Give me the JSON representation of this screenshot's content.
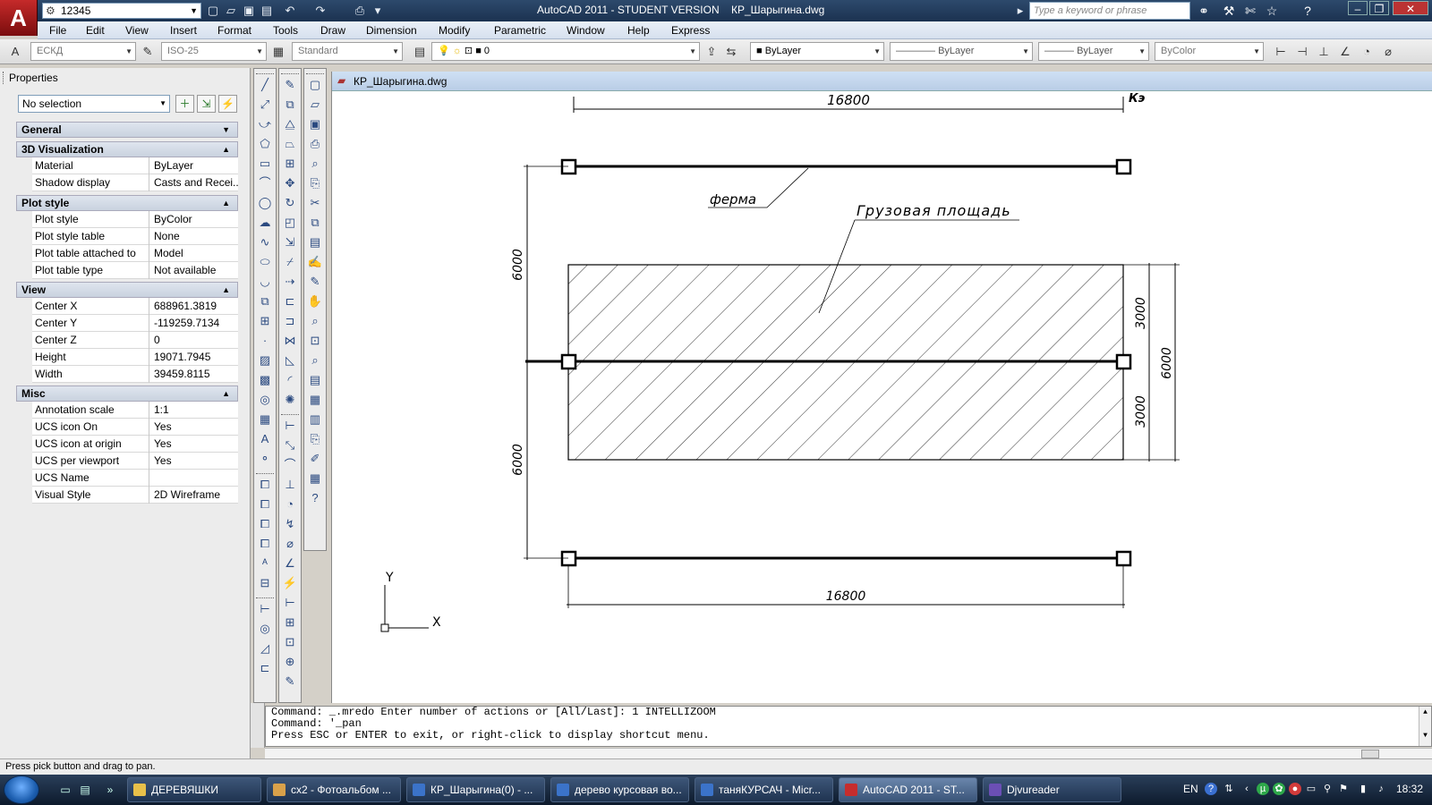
{
  "titlebar": {
    "workspace_value": "12345",
    "title": "AutoCAD 2011 - STUDENT VERSION    КР_Шарыгина.dwg",
    "search_placeholder": "Type a keyword or phrase"
  },
  "menu": [
    "File",
    "Edit",
    "View",
    "Insert",
    "Format",
    "Tools",
    "Draw",
    "Dimension",
    "Modify",
    "Parametric",
    "Window",
    "Help",
    "Express"
  ],
  "toolbar": {
    "text_style": "ЕСКД",
    "dim_style": "ISO-25",
    "table_style": "Standard",
    "layer": "0",
    "color": "ByLayer",
    "linetype": "ByLayer",
    "lineweight": "ByLayer",
    "plotstyle": "ByColor"
  },
  "properties": {
    "title": "Properties",
    "selection": "No selection",
    "categories": [
      {
        "name": "General",
        "rows": []
      },
      {
        "name": "3D Visualization",
        "rows": [
          {
            "name": "Material",
            "value": "ByLayer"
          },
          {
            "name": "Shadow display",
            "value": "Casts and Recei..."
          }
        ]
      },
      {
        "name": "Plot style",
        "rows": [
          {
            "name": "Plot style",
            "value": "ByColor"
          },
          {
            "name": "Plot style table",
            "value": "None"
          },
          {
            "name": "Plot table attached to",
            "value": "Model"
          },
          {
            "name": "Plot table type",
            "value": "Not available"
          }
        ]
      },
      {
        "name": "View",
        "rows": [
          {
            "name": "Center X",
            "value": "688961.3819"
          },
          {
            "name": "Center Y",
            "value": "-119259.7134"
          },
          {
            "name": "Center Z",
            "value": "0"
          },
          {
            "name": "Height",
            "value": "19071.7945"
          },
          {
            "name": "Width",
            "value": "39459.8115"
          }
        ]
      },
      {
        "name": "Misc",
        "rows": [
          {
            "name": "Annotation scale",
            "value": "1:1"
          },
          {
            "name": "UCS icon On",
            "value": "Yes"
          },
          {
            "name": "UCS icon at origin",
            "value": "Yes"
          },
          {
            "name": "UCS per viewport",
            "value": "Yes"
          },
          {
            "name": "UCS Name",
            "value": ""
          },
          {
            "name": "Visual Style",
            "value": "2D Wireframe"
          }
        ]
      }
    ]
  },
  "document": {
    "tab_label": "КР_Шарыгина.dwg",
    "drawing": {
      "dim_top": "16800",
      "dim_bottom": "16800",
      "dim_left_upper": "6000",
      "dim_left_lower": "6000",
      "dim_right_upper": "3000",
      "dim_right_lower": "3000",
      "dim_right_total": "6000",
      "label_truss": "ферма",
      "label_load_area": "Грузовая площадь",
      "corner_mark": "Кэ",
      "ucs_x": "X",
      "ucs_y": "Y"
    }
  },
  "command": {
    "lines": [
      "Command: _.mredo Enter number of actions or [All/Last]: 1 INTELLIZOOM",
      "Command: '_pan",
      "Press ESC or ENTER to exit, or right-click to display shortcut menu."
    ]
  },
  "status": "Press pick button and drag to pan.",
  "taskbar": {
    "items": [
      {
        "label": "ДЕРЕВЯШКИ",
        "color": "#e8c04a"
      },
      {
        "label": "сх2 - Фотоальбом ...",
        "color": "#d9a14a"
      },
      {
        "label": "КР_Шарыгина(0) - ...",
        "color": "#3b73c9"
      },
      {
        "label": "дерево курсовая во...",
        "color": "#3b73c9"
      },
      {
        "label": "таняКУРСАЧ - Micr...",
        "color": "#3b73c9"
      },
      {
        "label": "AutoCAD 2011 - ST...",
        "color": "#c62d2d"
      },
      {
        "label": "Djvureader",
        "color": "#6b4fb5"
      }
    ],
    "lang": "EN",
    "clock": "18:32"
  }
}
